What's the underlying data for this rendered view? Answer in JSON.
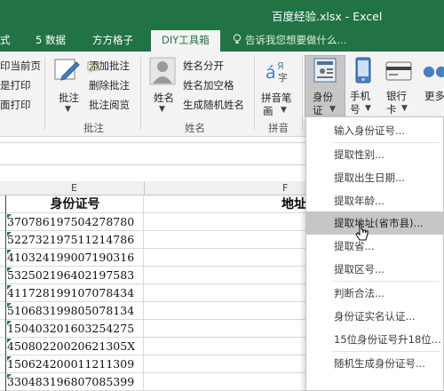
{
  "window": {
    "title": "百度经验.xlsx - Excel"
  },
  "tabs": [
    {
      "label": "式"
    },
    {
      "label": "5 数据"
    },
    {
      "label": "方方格子"
    },
    {
      "label": "DIY工具箱"
    }
  ],
  "tellme": {
    "placeholder": "告诉我您想要做什么..."
  },
  "ribbon": {
    "print": {
      "items": [
        "印当前页",
        "是打印",
        "面打印"
      ]
    },
    "comment_group": {
      "big_label": "批注",
      "items": [
        "添加批注",
        "删除批注",
        "批注阅览"
      ],
      "group_label": "批注"
    },
    "name_group": {
      "big_label": "姓名",
      "items": [
        "姓名分开",
        "姓名加空格",
        "生成随机姓名"
      ],
      "group_label": "姓名"
    },
    "pinyin_group": {
      "big_label_1": "拼音笔",
      "big_label_2": "画",
      "group_label": "拼音"
    },
    "id_button": {
      "label_1": "身份",
      "label_2": "证"
    },
    "phone_button": {
      "label_1": "手机",
      "label_2": "号"
    },
    "bank_button": {
      "label_1": "银行",
      "label_2": "卡"
    },
    "more_button": {
      "label": "更多"
    }
  },
  "sheet": {
    "columns": [
      "E",
      "F"
    ],
    "header": {
      "e": "身份证号",
      "f": "地址"
    },
    "rows": [
      "370786197504278780",
      "522732197511214786",
      "410324199007190316",
      "532502196402197583",
      "411728199107078434",
      "510683199805078134",
      "150403201603254275",
      "450802200206213​05X",
      "150624200011211309",
      "330483196807085399"
    ]
  },
  "menu": {
    "items": [
      "输入身份证号...",
      "提取性别...",
      "提取出生日期...",
      "提取年龄...",
      "提取地址(省市县)...",
      "提取省...",
      "提取区号...",
      "判断合法...",
      "身份证实名认证...",
      "15位身份证号升18位...",
      "随机生成身份证号..."
    ],
    "highlighted_index": 4
  }
}
